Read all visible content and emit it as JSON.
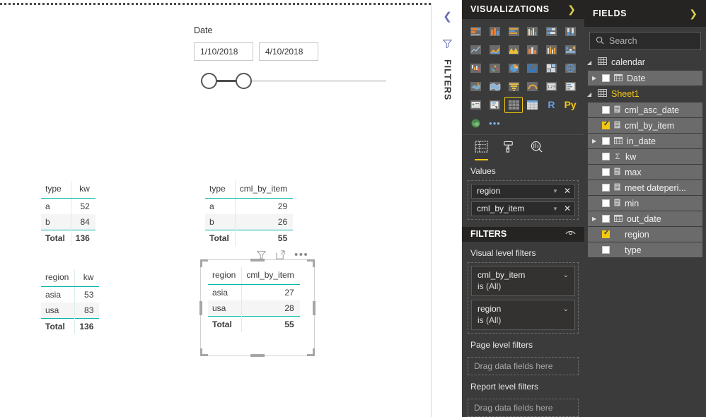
{
  "canvas": {
    "slicer": {
      "title": "Date",
      "start_value": "1/10/2018",
      "end_value": "4/10/2018"
    },
    "tables": [
      {
        "id": "type-kw",
        "headers": [
          "type",
          "kw"
        ],
        "rows": [
          [
            "a",
            "52"
          ],
          [
            "b",
            "84"
          ]
        ],
        "total": [
          "Total",
          "136"
        ]
      },
      {
        "id": "type-cml_by_item",
        "headers": [
          "type",
          "cml_by_item"
        ],
        "rows": [
          [
            "a",
            "29"
          ],
          [
            "b",
            "26"
          ]
        ],
        "total": [
          "Total",
          "55"
        ]
      },
      {
        "id": "region-kw",
        "headers": [
          "region",
          "kw"
        ],
        "rows": [
          [
            "asia",
            "53"
          ],
          [
            "usa",
            "83"
          ]
        ],
        "total": [
          "Total",
          "136"
        ]
      },
      {
        "id": "region-cml_by_item",
        "headers": [
          "region",
          "cml_by_item"
        ],
        "rows": [
          [
            "asia",
            "27"
          ],
          [
            "usa",
            "28"
          ]
        ],
        "total": [
          "Total",
          "55"
        ]
      }
    ]
  },
  "filters_rail": {
    "label": "FILTERS"
  },
  "visualizations": {
    "title": "VISUALIZATIONS",
    "icons": [
      "stacked-bar-chart-icon",
      "stacked-column-chart-icon",
      "clustered-bar-chart-icon",
      "clustered-column-chart-icon",
      "100-stacked-bar-chart-icon",
      "100-stacked-column-chart-icon",
      "line-chart-icon",
      "area-chart-icon",
      "stacked-area-chart-icon",
      "line-stacked-column-chart-icon",
      "line-clustered-column-chart-icon",
      "ribbon-chart-icon",
      "waterfall-chart-icon",
      "scatter-chart-icon",
      "pie-chart-icon",
      "donut-chart-icon",
      "treemap-icon",
      "map-icon",
      "filled-map-icon",
      "shape-map-icon",
      "funnel-chart-icon",
      "gauge-chart-icon",
      "card-icon",
      "multi-row-card-icon",
      "kpi-icon",
      "slicer-icon",
      "matrix-icon",
      "table-icon",
      "r-script-visual-icon",
      "python-visual-icon",
      "arcgis-map-icon",
      "more-visuals-icon"
    ],
    "selected_icon_index": 26,
    "tabs": [
      {
        "name": "fields-tab",
        "icon": "fields-grid-icon",
        "active": true
      },
      {
        "name": "format-tab",
        "icon": "paint-roller-icon",
        "active": false
      },
      {
        "name": "analytics-tab",
        "icon": "magnifier-chart-icon",
        "active": false
      }
    ],
    "values_label": "Values",
    "values": [
      "region",
      "cml_by_item"
    ]
  },
  "filters": {
    "title": "FILTERS",
    "visual_level_label": "Visual level filters",
    "cards": [
      {
        "field": "cml_by_item",
        "condition": "is (All)"
      },
      {
        "field": "region",
        "condition": "is (All)"
      }
    ],
    "page_level_label": "Page level filters",
    "page_level_placeholder": "Drag data fields here",
    "report_level_label": "Report level filters",
    "report_level_placeholder": "Drag data fields here"
  },
  "fields": {
    "title": "FIELDS",
    "search_placeholder": "Search",
    "tables": [
      {
        "name": "calendar",
        "highlighted": false,
        "fields": [
          {
            "label": "Date",
            "checked": false,
            "expandable": true,
            "icon": "calendar-icon"
          }
        ]
      },
      {
        "name": "Sheet1",
        "highlighted": true,
        "fields": [
          {
            "label": "cml_asc_date",
            "checked": false,
            "expandable": false,
            "icon": "text-field-icon"
          },
          {
            "label": "cml_by_item",
            "checked": true,
            "expandable": false,
            "icon": "text-field-icon"
          },
          {
            "label": "in_date",
            "checked": false,
            "expandable": true,
            "icon": "calendar-icon"
          },
          {
            "label": "kw",
            "checked": false,
            "expandable": false,
            "icon": "sigma-icon"
          },
          {
            "label": "max",
            "checked": false,
            "expandable": false,
            "icon": "text-field-icon"
          },
          {
            "label": "meet dateperi...",
            "checked": false,
            "expandable": false,
            "icon": "text-field-icon"
          },
          {
            "label": "min",
            "checked": false,
            "expandable": false,
            "icon": "text-field-icon"
          },
          {
            "label": "out_date",
            "checked": false,
            "expandable": true,
            "icon": "calendar-icon"
          },
          {
            "label": "region",
            "checked": true,
            "expandable": false,
            "icon": "none"
          },
          {
            "label": "type",
            "checked": false,
            "expandable": false,
            "icon": "none"
          }
        ]
      }
    ]
  },
  "colors": {
    "accent_yellow": "#f2c811",
    "table_rule_teal": "#01b8aa",
    "panel_bg": "#3b3b3b",
    "panel_header_bg": "#252423"
  }
}
